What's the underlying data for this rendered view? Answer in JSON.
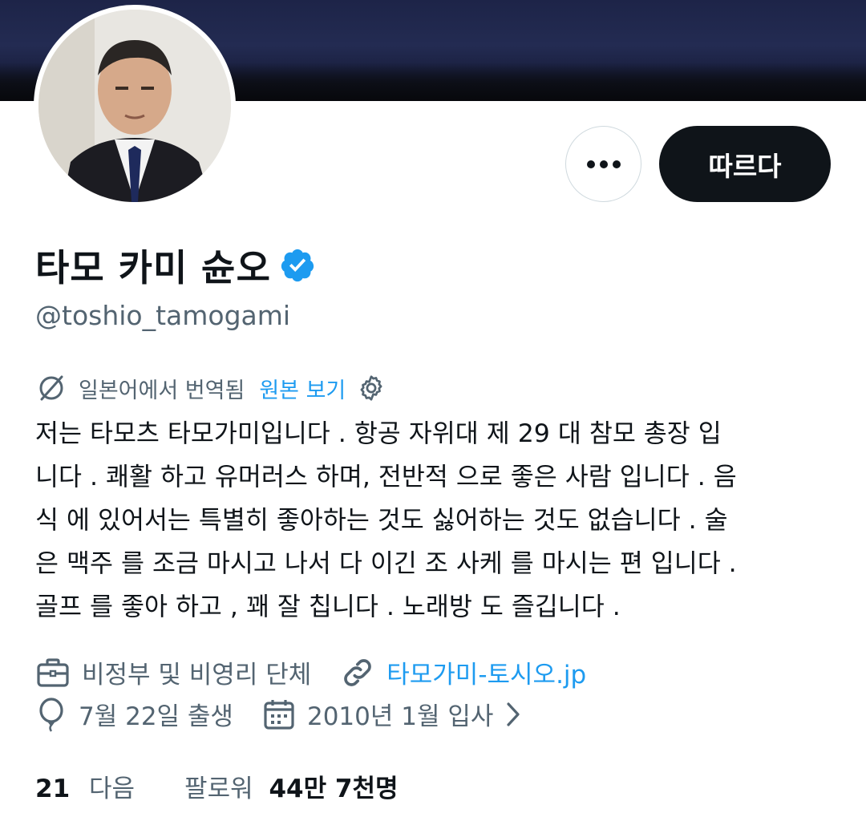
{
  "profile": {
    "name": "타모 카미 슌오",
    "handle": "@toshio_tamogami",
    "verified": true
  },
  "actions": {
    "more_label": "•••",
    "follow_label": "따르다"
  },
  "translation": {
    "notice": "일본어에서 번역됨",
    "view_original": "원본 보기"
  },
  "bio": "저는 타모츠 타모가미입니다 . 항공 자위대 제 29 대 참모 총장 입\n니다 . 쾌활 하고 유머러스 하며, 전반적 으로 좋은 사람 입니다 . 음\n식 에 있어서는 특별히 좋아하는 것도 싫어하는 것도 없습니다 . 술\n은 맥주 를 조금 마시고 나서 다 이긴 조 사케 를 마시는 편 입니다 .\n골프 를 좋아 하고 , 꽤 잘 칩니다 . 노래방 도 즐깁니다 .",
  "meta": {
    "category": "비정부 및 비영리 단체",
    "website": "타모가미-토시오.jp",
    "birthday": "7월 22일 출생",
    "joined": "2010년 1월 입사"
  },
  "stats": {
    "following_count": "21",
    "following_label": "다음",
    "followers_label": "팔로워",
    "followers_count": "44만 7천명"
  },
  "colors": {
    "accent": "#1d9bf0",
    "text": "#0f1419",
    "muted": "#536471",
    "follow_button_bg": "#0f1419"
  },
  "icons": [
    "translate-icon",
    "gear-icon",
    "briefcase-icon",
    "link-icon",
    "balloon-icon",
    "calendar-icon",
    "chevron-right-icon",
    "verified-badge-icon",
    "more-icon"
  ]
}
